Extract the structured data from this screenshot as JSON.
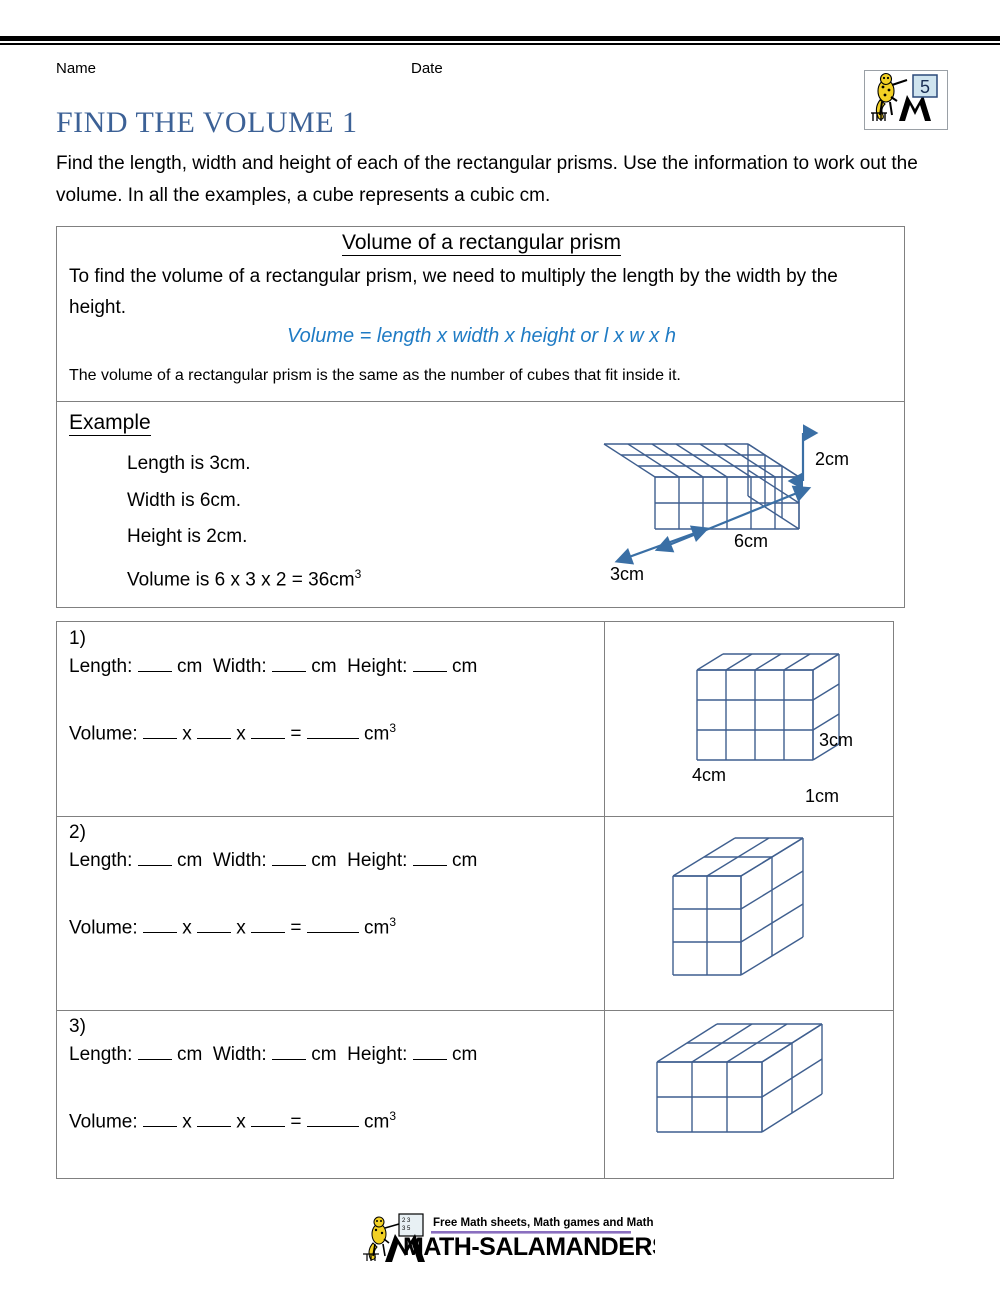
{
  "meta": {
    "name_label": "Name",
    "date_label": "Date"
  },
  "logo": {
    "grade": "5",
    "alt": "math-salamanders-logo"
  },
  "header": {
    "title": "FIND THE VOLUME 1",
    "intro": "Find the length, width and height of each of the rectangular prisms. Use the information to work out the volume. In all the examples, a cube represents a cubic cm."
  },
  "explanation": {
    "heading": "Volume of a rectangular prism",
    "body": "To find the volume of a rectangular prism, we need to multiply the length by the width by the height.",
    "formula": "Volume = length x width x height or l x w x h",
    "note": "The volume of a rectangular prism is the same as the number of cubes that fit inside it.",
    "example_label": "Example",
    "example_lines": [
      "Length is 3cm.",
      "Width is 6cm.",
      "Height is 2cm."
    ],
    "example_volume_prefix": "Volume is 6 x 3 x 2 = 36cm",
    "example_volume_sup": "3",
    "figure": {
      "length": 6,
      "depth": 3,
      "height": 2,
      "labels": {
        "height": "2cm",
        "length": "6cm",
        "depth": "3cm"
      }
    }
  },
  "questions": [
    {
      "number": "1)",
      "dims_line": {
        "length_label": "Length:",
        "width_label": "Width:",
        "height_label": "Height:",
        "unit": "cm"
      },
      "volume_line": {
        "label": "Volume:",
        "op": "x",
        "eq": "=",
        "unit": "cm",
        "sup": "3"
      },
      "figure": {
        "cols": 4,
        "depth": 1,
        "rows": 3,
        "labels": {
          "length": "4cm",
          "height": "3cm",
          "depth": "1cm"
        }
      }
    },
    {
      "number": "2)",
      "dims_line": {
        "length_label": "Length:",
        "width_label": "Width:",
        "height_label": "Height:",
        "unit": "cm"
      },
      "volume_line": {
        "label": "Volume:",
        "op": "x",
        "eq": "=",
        "unit": "cm",
        "sup": "3"
      },
      "figure": {
        "cols": 2,
        "depth": 2,
        "rows": 3,
        "labels": {}
      }
    },
    {
      "number": "3)",
      "dims_line": {
        "length_label": "Length:",
        "width_label": "Width:",
        "height_label": "Height:",
        "unit": "cm"
      },
      "volume_line": {
        "label": "Volume:",
        "op": "x",
        "eq": "=",
        "unit": "cm",
        "sup": "3"
      },
      "figure": {
        "cols": 3,
        "depth": 2,
        "rows": 2,
        "labels": {}
      }
    }
  ],
  "footer": {
    "tagline": "Free Math sheets, Math games and Math help",
    "brand": "MATH-SALAMANDERS.COM"
  },
  "colors": {
    "title_blue": "#3c6196",
    "formula_blue": "#1f7bc4",
    "prism_stroke": "#3f5f8f",
    "arrow_blue": "#3a6fa5",
    "border_gray": "#808080",
    "footer_purple": "#8a6fbf",
    "logo_yellow": "#f2d024"
  }
}
